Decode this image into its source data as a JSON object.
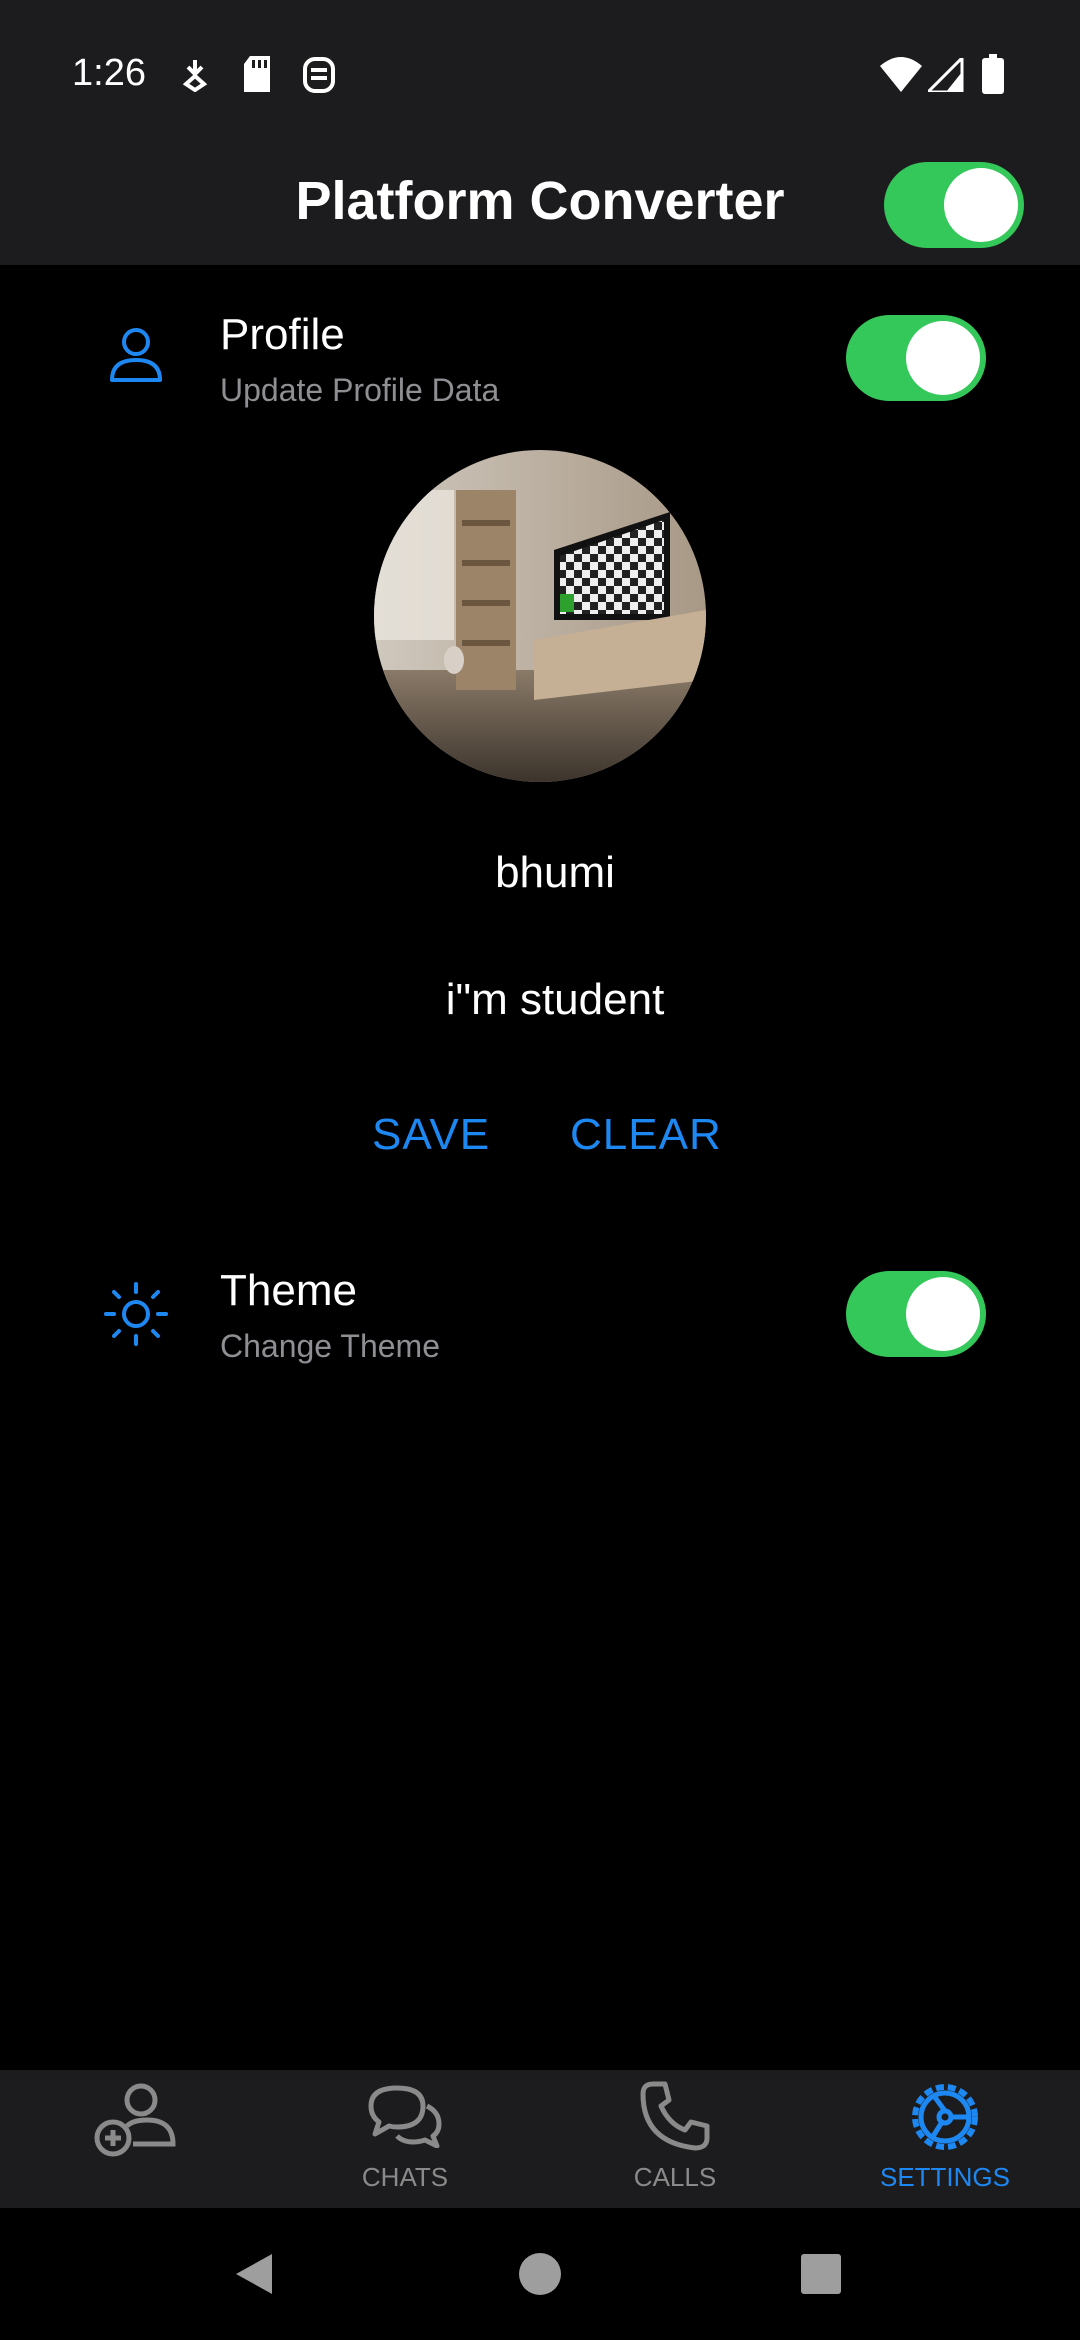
{
  "status_bar": {
    "time": "1:26",
    "left_icons": [
      "download-arrow-icon",
      "sd-card-icon",
      "shield-icon"
    ],
    "right_icons": [
      "wifi-icon",
      "signal-icon",
      "battery-icon"
    ]
  },
  "app_bar": {
    "title": "Platform Converter",
    "toggle_on": true
  },
  "profile": {
    "title": "Profile",
    "subtitle": "Update Profile Data",
    "toggle_on": true,
    "name": "bhumi",
    "bio": "i\"m student",
    "save_label": "SAVE",
    "clear_label": "CLEAR"
  },
  "theme": {
    "title": "Theme",
    "subtitle": "Change Theme",
    "toggle_on": true
  },
  "bottom_nav": {
    "items": [
      {
        "label": "",
        "icon": "add-person-icon",
        "active": false
      },
      {
        "label": "CHATS",
        "icon": "chat-bubbles-icon",
        "active": false
      },
      {
        "label": "CALLS",
        "icon": "phone-icon",
        "active": false
      },
      {
        "label": "SETTINGS",
        "icon": "settings-icon",
        "active": true
      }
    ]
  },
  "colors": {
    "accent": "#1e88f2",
    "toggle_on": "#34c759",
    "bar_bg": "#1c1c1e",
    "subtitle": "#8e8e93"
  }
}
